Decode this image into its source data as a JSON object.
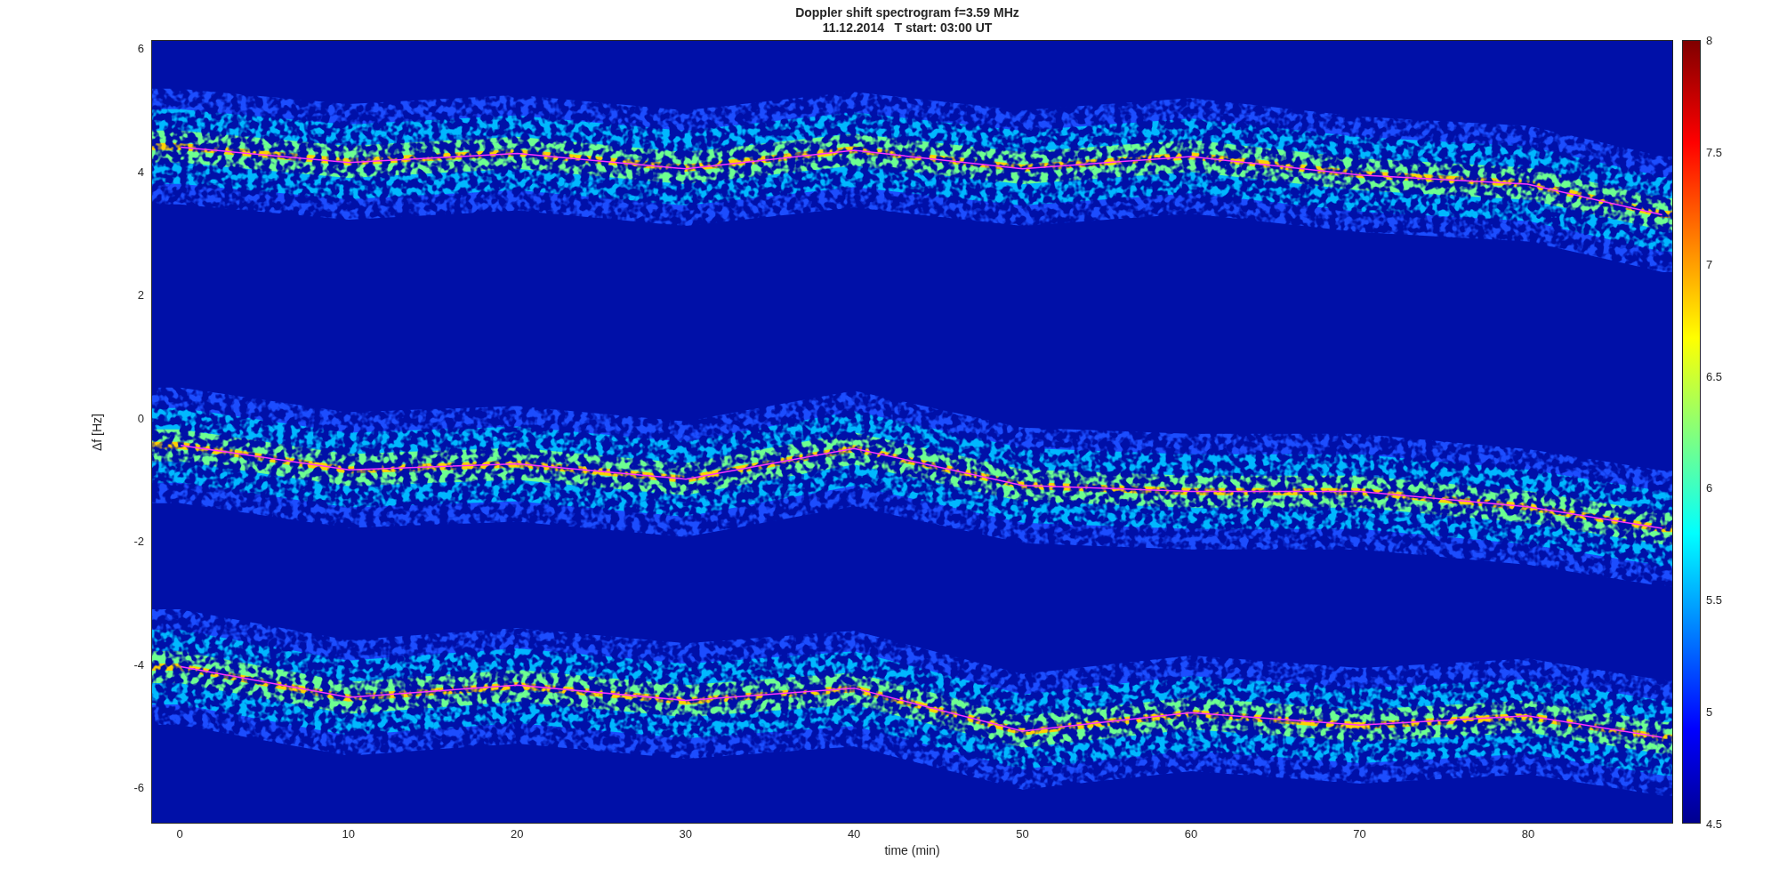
{
  "title": [
    "Doppler shift spectrogram f=3.59 MHz",
    "11.12.2014   T start: 03:00 UT"
  ],
  "spectrogram": {
    "chart_data": {
      "type": "line",
      "xlabel": "time (min)",
      "ylabel": "Δf [Hz]",
      "x": [
        0,
        10,
        20,
        30,
        40,
        50,
        60,
        70,
        80,
        88
      ],
      "series": [
        {
          "color": "#ff33ff",
          "values": [
            4.4,
            4.15,
            4.3,
            4.05,
            4.35,
            4.05,
            4.25,
            3.95,
            3.8,
            3.3
          ]
        },
        {
          "color": "#ff33ff",
          "values": [
            -0.45,
            -0.85,
            -0.75,
            -1.0,
            -0.5,
            -1.1,
            -1.2,
            -1.2,
            -1.45,
            -1.8
          ]
        },
        {
          "color": "#ff33ff",
          "values": [
            -4.05,
            -4.55,
            -4.35,
            -4.6,
            -4.4,
            -5.1,
            -4.8,
            -5.0,
            -4.85,
            -5.2
          ]
        }
      ],
      "xlim": [
        -1.7,
        88.6
      ],
      "ylim": [
        -6.59,
        6.13
      ],
      "xticks": [
        0,
        10,
        20,
        30,
        40,
        50,
        60,
        70,
        80
      ],
      "yticks": [
        6,
        4,
        2,
        0,
        -2,
        -4,
        -6
      ]
    }
  },
  "colorbar": {
    "ticks": [
      "8",
      "7.5",
      "7",
      "6.5",
      "6",
      "5.5",
      "5",
      "4.5"
    ]
  }
}
